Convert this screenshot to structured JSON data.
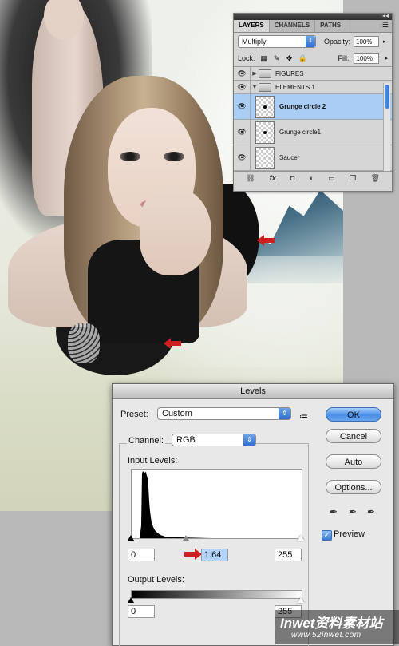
{
  "layers_panel": {
    "tabs": [
      "LAYERS",
      "CHANNELS",
      "PATHS"
    ],
    "blend_mode": "Multiply",
    "opacity_label": "Opacity:",
    "opacity_value": "100%",
    "lock_label": "Lock:",
    "fill_label": "Fill:",
    "fill_value": "100%",
    "layers": [
      {
        "name": "FIGURES",
        "type": "group",
        "expanded": false
      },
      {
        "name": "ELEMENTS 1",
        "type": "group",
        "expanded": true
      },
      {
        "name": "Grunge circle 2",
        "type": "layer",
        "selected": true
      },
      {
        "name": "Grunge circle1",
        "type": "layer",
        "selected": false
      },
      {
        "name": "Saucer",
        "type": "layer",
        "selected": false
      }
    ],
    "bottom_icons": [
      "link-icon",
      "fx-icon",
      "mask-icon",
      "adjustment-icon",
      "folder-icon",
      "new-layer-icon",
      "trash-icon"
    ]
  },
  "levels_dialog": {
    "title": "Levels",
    "preset_label": "Preset:",
    "preset_value": "Custom",
    "channel_label": "Channel:",
    "channel_value": "RGB",
    "input_levels_label": "Input Levels:",
    "input_black": "0",
    "input_gamma": "1.64",
    "input_white": "255",
    "output_levels_label": "Output Levels:",
    "output_black": "0",
    "output_white": "255",
    "buttons": {
      "ok": "OK",
      "cancel": "Cancel",
      "auto": "Auto",
      "options": "Options..."
    },
    "preview_label": "Preview",
    "preview_checked": true
  },
  "watermark": {
    "title": "Inwet资料素材站",
    "url": "www.52inwet.com"
  },
  "colors": {
    "selection": "#a9cdf5",
    "accent_blue": "#3d7ad6",
    "arrow_red": "#cc1f1f"
  }
}
